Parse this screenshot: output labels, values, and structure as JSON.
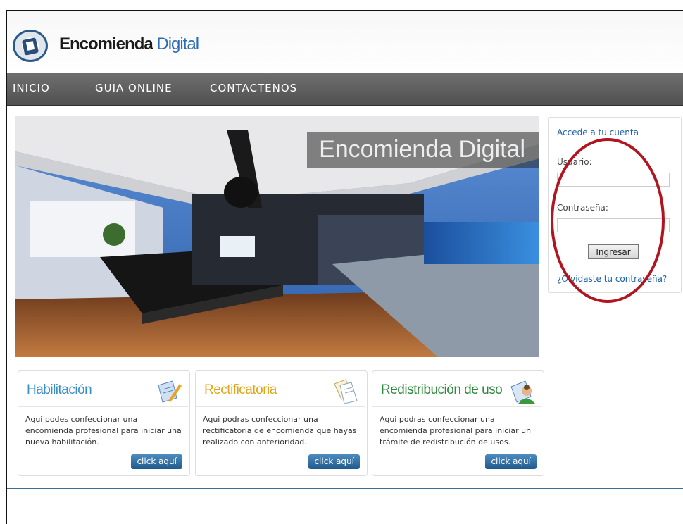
{
  "brand": {
    "name_part1": "Encomienda",
    "name_part2": "Digital"
  },
  "nav": {
    "items": [
      "INICIO",
      "GUIA ONLINE",
      "CONTACTENOS"
    ]
  },
  "hero": {
    "title": "Encomienda Digital"
  },
  "login": {
    "title": "Accede a tu cuenta",
    "user_label": "Usuario:",
    "user_value": "",
    "password_label": "Contraseña:",
    "password_value": "",
    "submit_label": "Ingresar",
    "forgot_label": "¿Olvidaste tu contraseña?"
  },
  "cards": [
    {
      "title": "Habilitación",
      "title_color": "#3a8ec8",
      "icon": "document-pen-icon",
      "description": "Aqui podes confeccionar una encomienda profesional para iniciar una nueva habilitación.",
      "button": "click aquí"
    },
    {
      "title": "Rectificatoria",
      "title_color": "#e2a413",
      "icon": "documents-icon",
      "description": "Aqui podras confeccionar una rectificatoria de encomienda que hayas realizado con anterioridad.",
      "button": "click aquí"
    },
    {
      "title": "Redistribución de uso",
      "title_color": "#2f8a3c",
      "icon": "user-document-icon",
      "description": "Aqui podras confeccionar una encomienda profesional para iniciar un trámite de redistribución de usos.",
      "button": "click aquí"
    }
  ],
  "colors": {
    "nav_bg": "#5b5b5b",
    "link": "#1b5fa6",
    "annotation": "#b1151f",
    "button": "#2a6a9e"
  }
}
